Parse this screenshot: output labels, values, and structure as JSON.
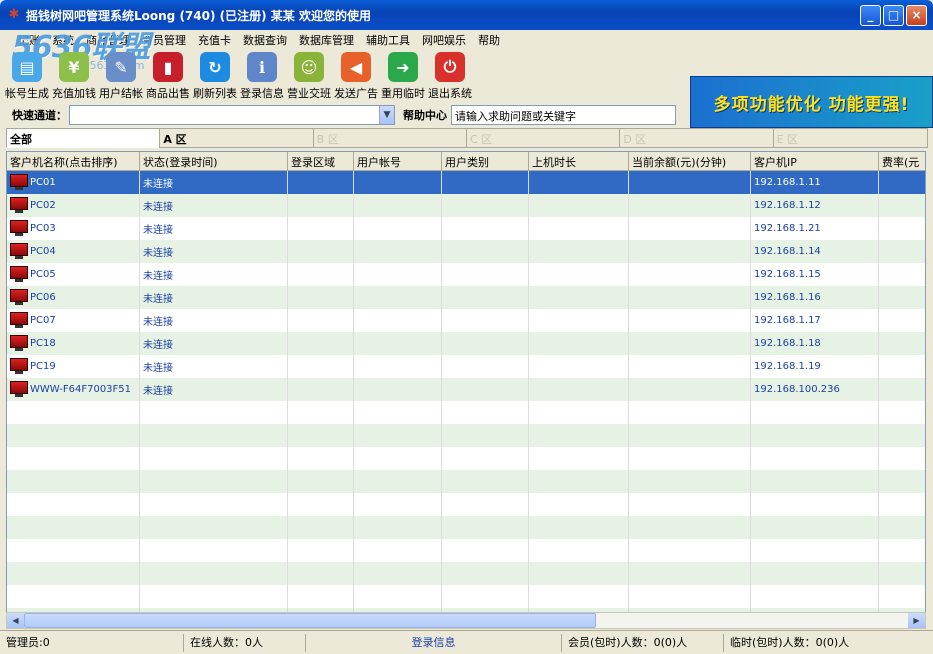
{
  "window": {
    "title": "摇钱树网吧管理系统Loong (740) (已注册)    某某 欢迎您的使用",
    "min": "_",
    "max": "□",
    "close": "×"
  },
  "logo": {
    "text": "5636联盟",
    "sub": "www.5636.com"
  },
  "menu": [
    "记账",
    "系统",
    "商品管理",
    "会员管理",
    "充值卡",
    "数据查询",
    "数据库管理",
    "辅助工具",
    "网吧娱乐",
    "帮助"
  ],
  "toolbar": [
    {
      "label": "帐号生成",
      "icon": "card-icon",
      "color": "#4aa7e8",
      "glyph": "▤"
    },
    {
      "label": "充值加钱",
      "icon": "money-icon",
      "color": "#8cc04a",
      "glyph": "¥"
    },
    {
      "label": "用户结帐",
      "icon": "cashier-icon",
      "color": "#6a8fc8",
      "glyph": "✎"
    },
    {
      "label": "商品出售",
      "icon": "soda-can-icon",
      "color": "#c8202a",
      "glyph": "▮"
    },
    {
      "label": "刷新列表",
      "icon": "refresh-icon",
      "color": "#1d8be0",
      "glyph": "↻"
    },
    {
      "label": "登录信息",
      "icon": "users-info-icon",
      "color": "#5f86c9",
      "glyph": "ℹ"
    },
    {
      "label": "营业交班",
      "icon": "shift-users-icon",
      "color": "#8ab33a",
      "glyph": "☺"
    },
    {
      "label": "发送广告",
      "icon": "megaphone-icon",
      "color": "#e8602a",
      "glyph": "◀"
    },
    {
      "label": "重用临时",
      "icon": "recycle-icon",
      "color": "#2aa84a",
      "glyph": "➜"
    },
    {
      "label": "退出系统",
      "icon": "power-icon",
      "color": "#d8302a",
      "glyph": "⏻"
    }
  ],
  "banner": {
    "text": "多项功能优化 功能更强!"
  },
  "quick": {
    "label": "快速通道：",
    "select_value": "",
    "help_label": "帮助中心",
    "help_placeholder": "请输入求助问题或关键字"
  },
  "areas": [
    {
      "label": "全部",
      "state": "active"
    },
    {
      "label": "A 区",
      "state": "normal"
    },
    {
      "label": "B 区",
      "state": "disabled"
    },
    {
      "label": "C 区",
      "state": "disabled"
    },
    {
      "label": "D 区",
      "state": "disabled"
    },
    {
      "label": "E 区",
      "state": "disabled"
    }
  ],
  "table": {
    "columns": [
      "客户机名称(点击排序)",
      "状态(登录时间)",
      "登录区域",
      "用户帐号",
      "用户类别",
      "上机时长",
      "当前余额(元)(分钟)",
      "客户机IP",
      "费率(元"
    ],
    "rows": [
      {
        "name": "PC01",
        "status": "未连接",
        "ip": "192.168.1.11"
      },
      {
        "name": "PC02",
        "status": "未连接",
        "ip": "192.168.1.12"
      },
      {
        "name": "PC03",
        "status": "未连接",
        "ip": "192.168.1.21"
      },
      {
        "name": "PC04",
        "status": "未连接",
        "ip": "192.168.1.14"
      },
      {
        "name": "PC05",
        "status": "未连接",
        "ip": "192.168.1.15"
      },
      {
        "name": "PC06",
        "status": "未连接",
        "ip": "192.168.1.16"
      },
      {
        "name": "PC07",
        "status": "未连接",
        "ip": "192.168.1.17"
      },
      {
        "name": "PC18",
        "status": "未连接",
        "ip": "192.168.1.18"
      },
      {
        "name": "PC19",
        "status": "未连接",
        "ip": "192.168.1.19"
      },
      {
        "name": "WWW-F64F7003F51",
        "status": "未连接",
        "ip": "192.168.100.236"
      }
    ]
  },
  "status": {
    "admin": "管理员:0",
    "online": "在线人数：0人",
    "login_info": "登录信息",
    "member": "会员(包时)人数：0(0)人",
    "temp": "临时(包时)人数：0(0)人"
  }
}
